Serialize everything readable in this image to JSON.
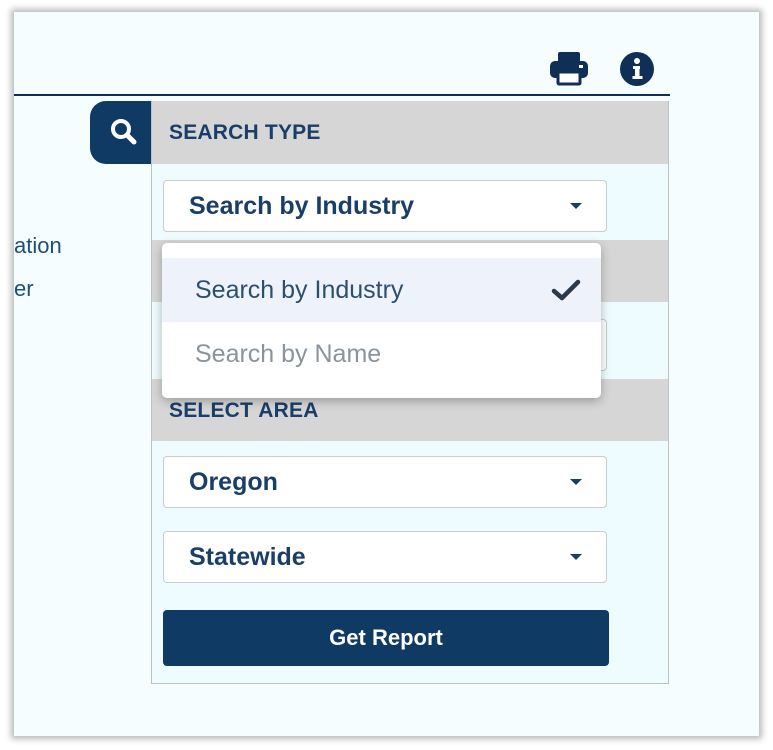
{
  "left_text": {
    "line1": "ation",
    "line2": "er"
  },
  "toolbar": {
    "print_icon": "printer-icon",
    "info_icon": "info-circle-icon"
  },
  "search_panel": {
    "search_icon": "search-icon",
    "search_type_heading": "SEARCH TYPE",
    "search_type_value": "Search by Industry",
    "select_area_heading": "SELECT AREA",
    "area_state_value": "Oregon",
    "area_region_value": "Statewide",
    "get_report_label": "Get Report"
  },
  "dropdown": {
    "options": [
      {
        "label": "Search by Industry",
        "selected": true
      },
      {
        "label": "Search by Name",
        "selected": false
      }
    ],
    "check_icon": "checkmark-icon"
  },
  "colors": {
    "navy": "#0f3a63",
    "heading_text": "#1b3e68",
    "panel_bg": "#eefcff",
    "section_bg": "#d6d6d6"
  }
}
